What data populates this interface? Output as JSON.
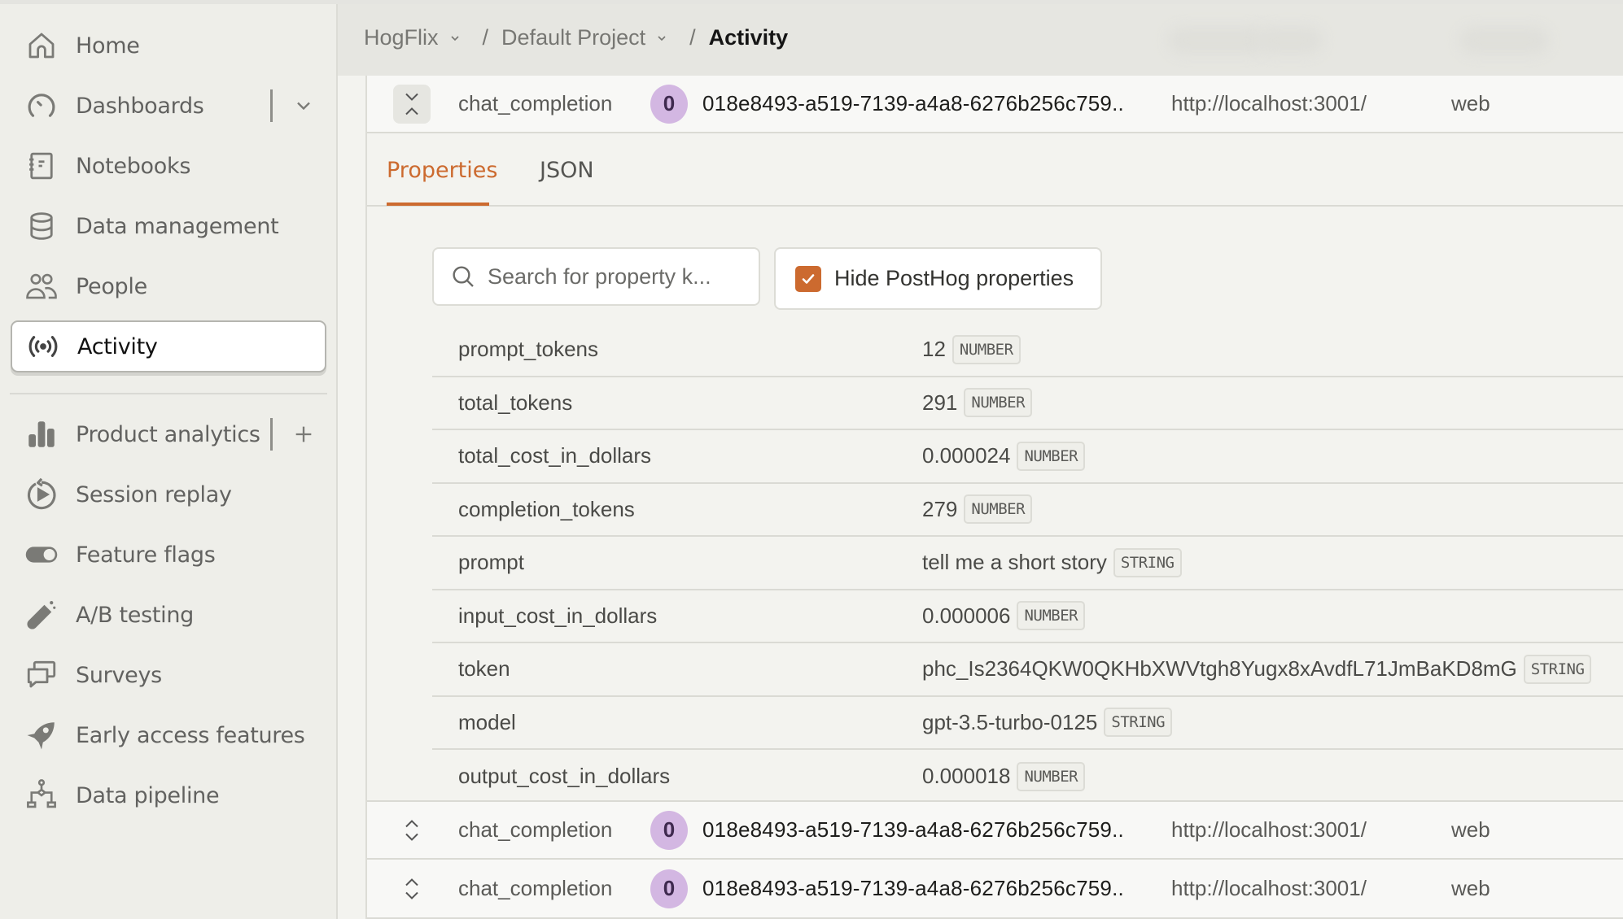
{
  "sidebar": {
    "items": [
      {
        "label": "Home",
        "icon": "home-icon"
      },
      {
        "label": "Dashboards",
        "icon": "dashboard-gauge-icon",
        "extra": "chevron-down-icon"
      },
      {
        "label": "Notebooks",
        "icon": "notebook-icon"
      },
      {
        "label": "Data management",
        "icon": "database-icon"
      },
      {
        "label": "People",
        "icon": "people-icon"
      },
      {
        "label": "Activity",
        "icon": "broadcast-icon",
        "active": true
      },
      {
        "label": "Product analytics",
        "icon": "bar-chart-icon",
        "extra": "plus-icon"
      },
      {
        "label": "Session replay",
        "icon": "replay-icon"
      },
      {
        "label": "Feature flags",
        "icon": "toggle-icon"
      },
      {
        "label": "A/B testing",
        "icon": "flask-icon"
      },
      {
        "label": "Surveys",
        "icon": "chat-bubbles-icon"
      },
      {
        "label": "Early access features",
        "icon": "rocket-icon"
      },
      {
        "label": "Data pipeline",
        "icon": "pipeline-icon"
      }
    ]
  },
  "header": {
    "breadcrumb": [
      {
        "label": "HogFlix",
        "has_dropdown": true
      },
      {
        "label": "Default Project",
        "has_dropdown": true
      },
      {
        "label": "Activity",
        "current": true
      }
    ]
  },
  "events": [
    {
      "name": "chat_completion",
      "person_initial": "0",
      "distinct_id": "018e8493-a519-7139-a4a8-6276b256c759..",
      "url": "http://localhost:3001/",
      "library": "web",
      "expanded": true
    },
    {
      "name": "chat_completion",
      "person_initial": "0",
      "distinct_id": "018e8493-a519-7139-a4a8-6276b256c759..",
      "url": "http://localhost:3001/",
      "library": "web",
      "expanded": false
    },
    {
      "name": "chat_completion",
      "person_initial": "0",
      "distinct_id": "018e8493-a519-7139-a4a8-6276b256c759..",
      "url": "http://localhost:3001/",
      "library": "web",
      "expanded": false
    }
  ],
  "details": {
    "tabs": [
      {
        "label": "Properties",
        "active": true
      },
      {
        "label": "JSON",
        "active": false
      }
    ],
    "search": {
      "placeholder": "Search for property k...",
      "value": ""
    },
    "hide_posthog": {
      "label": "Hide PostHog properties",
      "checked": true
    },
    "properties": [
      {
        "key": "prompt_tokens",
        "value": "12",
        "type": "NUMBER"
      },
      {
        "key": "total_tokens",
        "value": "291",
        "type": "NUMBER"
      },
      {
        "key": "total_cost_in_dollars",
        "value": "0.000024",
        "type": "NUMBER"
      },
      {
        "key": "completion_tokens",
        "value": "279",
        "type": "NUMBER"
      },
      {
        "key": "prompt",
        "value": "tell me a short story",
        "type": "STRING"
      },
      {
        "key": "input_cost_in_dollars",
        "value": "0.000006",
        "type": "NUMBER"
      },
      {
        "key": "token",
        "value": "phc_Is2364QKW0QKHbXWVtgh8Yugx8xAvdfL71JmBaKD8mG",
        "type": "STRING"
      },
      {
        "key": "model",
        "value": "gpt-3.5-turbo-0125",
        "type": "STRING"
      },
      {
        "key": "output_cost_in_dollars",
        "value": "0.000018",
        "type": "NUMBER"
      }
    ]
  },
  "colors": {
    "accent": "#cc6a2f",
    "avatar_bg": "#d3b7e2",
    "sidebar_bg": "#eeeee9",
    "content_bg": "#f3f3ef"
  }
}
